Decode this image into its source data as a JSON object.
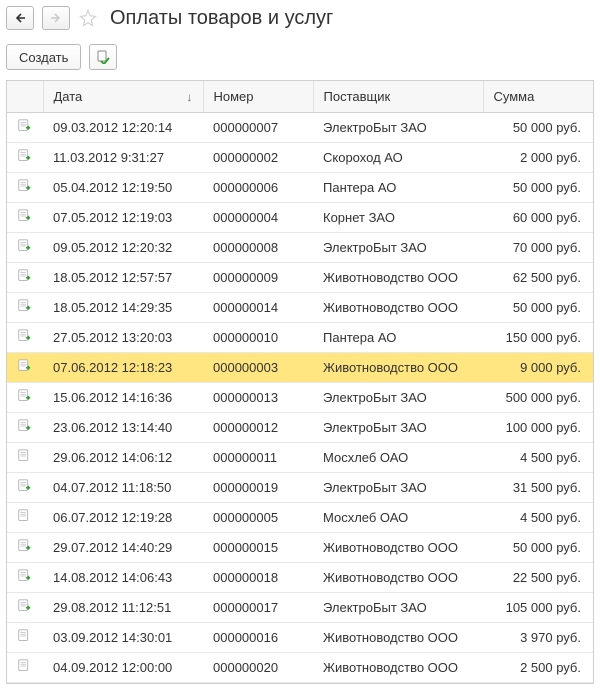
{
  "header": {
    "title": "Оплаты товаров и услуг"
  },
  "toolbar": {
    "create_label": "Создать"
  },
  "columns": {
    "date": "Дата",
    "number": "Номер",
    "supplier": "Поставщик",
    "sum": "Сумма"
  },
  "rows": [
    {
      "date": "09.03.2012 12:20:14",
      "number": "000000007",
      "supplier": "ЭлектроБыт ЗАО",
      "sum": "50 000 руб.",
      "posted": true
    },
    {
      "date": "11.03.2012 9:31:27",
      "number": "000000002",
      "supplier": "Скороход АО",
      "sum": "2 000 руб.",
      "posted": true
    },
    {
      "date": "05.04.2012 12:19:50",
      "number": "000000006",
      "supplier": "Пантера АО",
      "sum": "50 000 руб.",
      "posted": true
    },
    {
      "date": "07.05.2012 12:19:03",
      "number": "000000004",
      "supplier": "Корнет ЗАО",
      "sum": "60 000 руб.",
      "posted": true
    },
    {
      "date": "09.05.2012 12:20:32",
      "number": "000000008",
      "supplier": "ЭлектроБыт ЗАО",
      "sum": "70 000 руб.",
      "posted": true
    },
    {
      "date": "18.05.2012 12:57:57",
      "number": "000000009",
      "supplier": "Животноводство ООО",
      "sum": "62 500 руб.",
      "posted": true
    },
    {
      "date": "18.05.2012 14:29:35",
      "number": "000000014",
      "supplier": "Животноводство ООО",
      "sum": "50 000 руб.",
      "posted": true
    },
    {
      "date": "27.05.2012 13:20:03",
      "number": "000000010",
      "supplier": "Пантера АО",
      "sum": "150 000 руб.",
      "posted": true
    },
    {
      "date": "07.06.2012 12:18:23",
      "number": "000000003",
      "supplier": "Животноводство ООО",
      "sum": "9 000 руб.",
      "posted": true,
      "selected": true
    },
    {
      "date": "15.06.2012 14:16:36",
      "number": "000000013",
      "supplier": "ЭлектроБыт ЗАО",
      "sum": "500 000 руб.",
      "posted": true
    },
    {
      "date": "23.06.2012 13:14:40",
      "number": "000000012",
      "supplier": "ЭлектроБыт ЗАО",
      "sum": "100 000 руб.",
      "posted": true
    },
    {
      "date": "29.06.2012 14:06:12",
      "number": "000000011",
      "supplier": "Мосхлеб ОАО",
      "sum": "4 500 руб.",
      "posted": false
    },
    {
      "date": "04.07.2012 11:18:50",
      "number": "000000019",
      "supplier": "ЭлектроБыт ЗАО",
      "sum": "31 500 руб.",
      "posted": true
    },
    {
      "date": "06.07.2012 12:19:28",
      "number": "000000005",
      "supplier": "Мосхлеб ОАО",
      "sum": "4 500 руб.",
      "posted": false
    },
    {
      "date": "29.07.2012 14:40:29",
      "number": "000000015",
      "supplier": "Животноводство ООО",
      "sum": "50 000 руб.",
      "posted": true
    },
    {
      "date": "14.08.2012 14:06:43",
      "number": "000000018",
      "supplier": "Животноводство ООО",
      "sum": "22 500 руб.",
      "posted": true
    },
    {
      "date": "29.08.2012 11:12:51",
      "number": "000000017",
      "supplier": "ЭлектроБыт ЗАО",
      "sum": "105 000 руб.",
      "posted": true
    },
    {
      "date": "03.09.2012 14:30:01",
      "number": "000000016",
      "supplier": "Животноводство ООО",
      "sum": "3 970 руб.",
      "posted": false
    },
    {
      "date": "04.09.2012 12:00:00",
      "number": "000000020",
      "supplier": "Животноводство ООО",
      "sum": "2 500 руб.",
      "posted": false
    }
  ]
}
